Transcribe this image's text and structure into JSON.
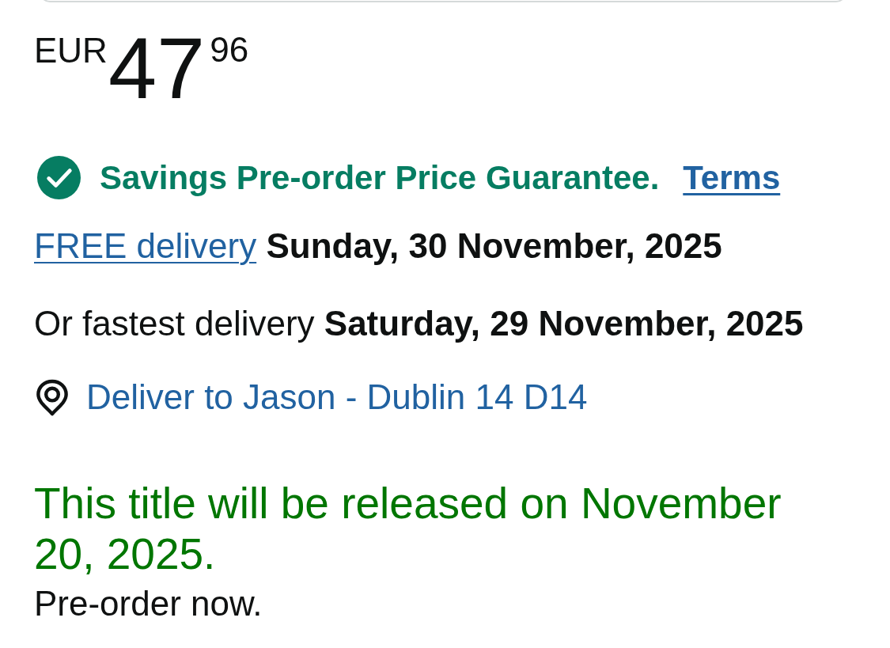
{
  "price": {
    "currency": "EUR",
    "whole": "47",
    "fraction": "96"
  },
  "guarantee": {
    "text": "Savings Pre-order Price Guarantee.",
    "link": "Terms"
  },
  "delivery": {
    "link": "FREE delivery",
    "date": "Sunday, 30 November, 2025"
  },
  "fastest_delivery": {
    "label": "Or fastest delivery",
    "date": "Saturday, 29 November, 2025"
  },
  "deliver_to": {
    "text": "Deliver to Jason - Dublin 14 D14"
  },
  "release": {
    "message": "This title will be released on November 20, 2025.",
    "note": "Pre-order now."
  }
}
